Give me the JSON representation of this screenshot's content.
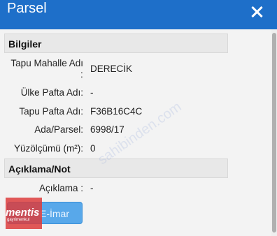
{
  "window": {
    "title": "Parsel"
  },
  "sections": {
    "info": "Bilgiler",
    "notes": "Açıklama/Not"
  },
  "fields": {
    "tapu_mahalle": {
      "label": "Tapu Mahalle Adı",
      "colon": ":",
      "value": "DERECİK"
    },
    "ulke_pafta": {
      "label": "Ülke Pafta Adı:",
      "value": "-"
    },
    "tapu_pafta": {
      "label": "Tapu Pafta Adı:",
      "value": "F36B16C4C"
    },
    "ada_parsel": {
      "label": "Ada/Parsel:",
      "value": "6998/17"
    },
    "yuzolcumu": {
      "label": "Yüzölçümü (m²):",
      "value": "0"
    },
    "aciklama": {
      "label": "Açıklama :",
      "value": "-"
    }
  },
  "buttons": {
    "imar": "E-İmar"
  },
  "logo": {
    "text": "mentis",
    "subtext": "gayrimenkul"
  },
  "watermark": "sahibinden.com",
  "colors": {
    "titlebar": "#1e6fc9",
    "button": "#58a8ea"
  }
}
